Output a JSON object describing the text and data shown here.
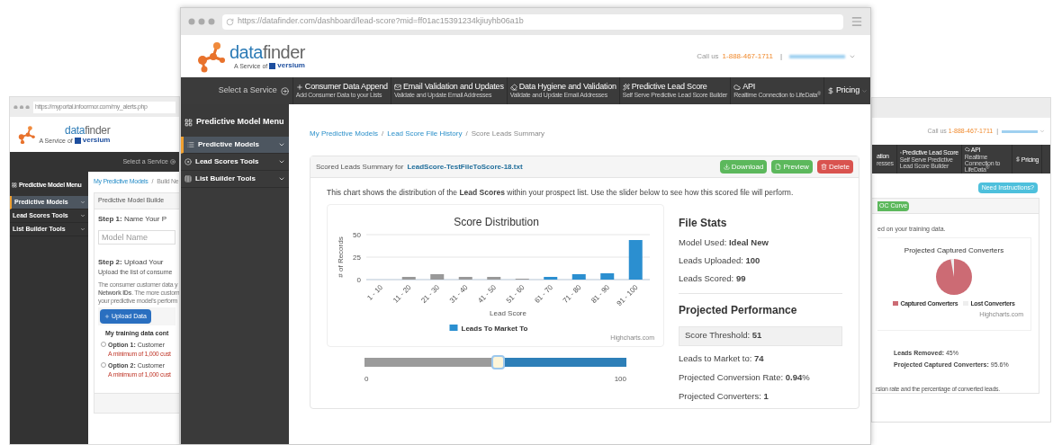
{
  "left_window": {
    "address_bar": {
      "url": "https://myportal.infoormor.com/my_alerts.php"
    },
    "logo": {
      "name_part_1": "data",
      "name_part_2": "finder",
      "tagline": "A Service of",
      "brand": "versium"
    },
    "select_label": "Select a Service",
    "sidebar": {
      "title": "Predictive Model Menu",
      "items": [
        {
          "label": "Predictive Models",
          "selected": true
        },
        {
          "label": "Lead Scores Tools",
          "selected": false
        },
        {
          "label": "List Builder Tools",
          "selected": false
        }
      ]
    },
    "breadcrumbs": [
      {
        "label": "My Predictive Models",
        "kind": "link"
      },
      {
        "separator_before": "/",
        "label": "Build Ne",
        "kind": "current"
      }
    ],
    "card_title": "Predictive Model Builde",
    "step1": "**Step 1:** Name Your P",
    "model_name": {
      "placeholder": "Model Name"
    },
    "step2": "**Step 2:** Upload Your",
    "step2_hint": "Upload the list of consume",
    "paragraph_lines": [
      "The consumer customer data y",
      "**Network IDs**. The more custom",
      "your predictive model's perform"
    ],
    "upload_button": "Upload Data",
    "training_title": "My training data cont",
    "options": [
      {
        "text": "**Option 1:** Customer",
        "note": "A minimum of 1,000 cust",
        "selected": false
      },
      {
        "text": "**Option 2:** Customer",
        "note": "A minimum of 1,000 cust",
        "selected": false
      }
    ]
  },
  "right_window": {
    "header": {
      "call_label": "Call us",
      "phone": "1-888-467-1711",
      "separator": "|"
    },
    "nav": [
      {
        "title": "ation",
        "subtitle": "resses"
      },
      {
        "title": "Predictive Lead Score",
        "subtitle": "Self Serve Predictive Lead Score Builder"
      },
      {
        "title": "API",
        "subtitle": "Realtime Connection to LifeData$^{®}$"
      },
      {
        "title": "Pricing"
      }
    ],
    "instructions_button": "Need Instructions?",
    "tab_button": "OC Curve",
    "intro": "ed on your training data.",
    "pie": {
      "title": "Projected Captured Converters",
      "legend": [
        {
          "label": "Captured Converters",
          "color": "#cc6b74"
        },
        {
          "label": "Lost Converters",
          "color": "#eeeeee"
        }
      ],
      "credit": "Highcharts.com"
    },
    "stats": [
      "**Leads Removed:** 45%",
      "**Projected Captured Converters:** 95.6%"
    ],
    "footer": "rsion rate and the percentage of converted leads."
  },
  "main_window": {
    "address_bar": {
      "url": "https://datafinder.com/dashboard/lead-score?mid=ff01ac15391234kjiuyhb06a1b"
    },
    "logo": {
      "name_part_1": "data",
      "name_part_2": "finder",
      "tagline": "A Service of",
      "brand": "versium"
    },
    "header": {
      "call_label": "Call us",
      "phone": "1-888-467-1711",
      "separator": "|"
    },
    "nav": {
      "select_label": "Select a Service",
      "items": [
        {
          "title": "Consumer Data Append",
          "subtitle": "Add Consumer Data to your Lists"
        },
        {
          "title": "Email Validation and Updates",
          "subtitle": "Validate and Update Email Addresses"
        },
        {
          "title": "Data Hygiene and Validation",
          "subtitle": "Validate and Update Email Addresses"
        },
        {
          "title": "Predictive Lead Score",
          "subtitle": "Self Serve Predictive Lead Score Builder"
        },
        {
          "title": "API",
          "subtitle": "Realtime Connection to LifeData$^{®}$"
        },
        {
          "title": "Pricing"
        }
      ]
    },
    "sidebar": {
      "title": "Predictive Model Menu",
      "items": [
        {
          "label": "Predictive Models",
          "selected": true
        },
        {
          "label": "Lead Scores Tools",
          "selected": false
        },
        {
          "label": "List Builder Tools",
          "selected": false
        }
      ]
    },
    "breadcrumbs": [
      {
        "label": "My Predictive Models",
        "kind": "link"
      },
      {
        "separator_before": "/",
        "label": "Lead Score File History",
        "kind": "link"
      },
      {
        "separator_before": "/",
        "label": "Score Leads Summary",
        "kind": "current"
      }
    ],
    "card": {
      "title_prefix": "Scored Leads Summary for",
      "file_name": "LeadScore-TestFileToScore-18.txt",
      "buttons": [
        {
          "label": "Download",
          "kind": "download"
        },
        {
          "label": "Preview",
          "kind": "preview"
        },
        {
          "label": "Delete",
          "kind": "delete"
        }
      ],
      "description": "This chart shows the distribution of the **Lead Scores** within your prospect list. Use the slider below to see how this scored file will perform.",
      "chart_data": {
        "type": "bar",
        "title": "Score Distribution",
        "xlabel": "Lead Score",
        "ylabel": "# of Records",
        "categories": [
          "1 - 10",
          "11 - 20",
          "21 - 30",
          "31 - 40",
          "41 - 50",
          "51 - 60",
          "61 - 70",
          "71 - 80",
          "81 - 90",
          "91 - 100"
        ],
        "series": [
          {
            "color": "#999999",
            "values": [
              0,
              3,
              6,
              3,
              3,
              1,
              null,
              null,
              null,
              null
            ]
          },
          {
            "name": "Leads To Market To",
            "color": "#2b8fd0",
            "values": [
              null,
              null,
              null,
              null,
              null,
              null,
              3,
              6,
              7,
              44
            ]
          }
        ],
        "ylim": [
          0,
          50
        ],
        "yticks": [
          0,
          25,
          50
        ]
      },
      "credit": "Highcharts.com",
      "slider": {
        "level": 0.51,
        "min_label": "0",
        "max_label": "100"
      },
      "file_stats": {
        "title": "File Stats",
        "rows": [
          "Model Used: **Ideal New**",
          "Leads Uploaded: **100**",
          "Leads Scored: **99**"
        ]
      },
      "performance": {
        "title": "Projected Performance",
        "threshold": "Score Threshold: **51**",
        "rows": [
          "Leads to Market to: **74**",
          "Projected Conversion Rate: **0.94**%",
          "Projected Converters: **1**"
        ]
      }
    }
  }
}
